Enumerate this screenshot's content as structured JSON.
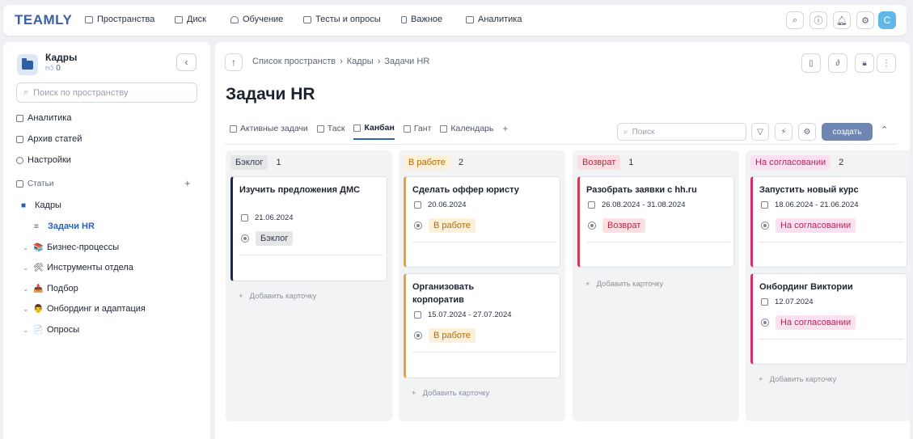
{
  "app": {
    "logo": "TEAMLY"
  },
  "topnav": {
    "items": [
      {
        "label": "Пространства",
        "icon": "spaces-icon"
      },
      {
        "label": "Диск",
        "icon": "folder-icon"
      },
      {
        "label": "Обучение",
        "icon": "graduation-icon"
      },
      {
        "label": "Тесты и опросы",
        "icon": "test-icon"
      },
      {
        "label": "Важное",
        "icon": "bookmark-icon"
      },
      {
        "label": "Аналитика",
        "icon": "analytics-icon"
      }
    ],
    "avatar": "C"
  },
  "sidebar": {
    "space_title": "Кадры",
    "likes": "0",
    "search_placeholder": "Поиск по пространству",
    "links": [
      "Аналитика",
      "Архив статей",
      "Настройки"
    ],
    "articles_label": "Статьи",
    "tree": [
      {
        "label": "Кадры",
        "emoji": "📁"
      },
      {
        "label": "Задачи HR",
        "emoji": "≡"
      },
      {
        "label": "Бизнес-процессы",
        "emoji": "📚"
      },
      {
        "label": "Инструменты отдела",
        "emoji": "🛠"
      },
      {
        "label": "Подбор",
        "emoji": "📥"
      },
      {
        "label": "Онбординг и адаптация",
        "emoji": "👨‍💼"
      },
      {
        "label": "Опросы",
        "emoji": "📄"
      }
    ]
  },
  "main": {
    "breadcrumb": [
      "Список пространств",
      "Кадры",
      "Задачи HR"
    ],
    "title": "Задачи HR",
    "tabs": [
      "Активные задачи",
      "Таск",
      "Канбан",
      "Гант",
      "Календарь"
    ],
    "active_tab": "Канбан",
    "search_placeholder": "Поиск",
    "create_label": "создать"
  },
  "board": {
    "add_card_label": "Добавить карточку",
    "columns": [
      {
        "name": "Бэклог",
        "count": "1",
        "color": "#1d2a4e",
        "badge_bg": "#e4e6ea",
        "badge_fg": "#333a47",
        "cards": [
          {
            "title": "Изучить предложения ДМС",
            "date": "21.06.2024",
            "status": "Бэклог"
          }
        ]
      },
      {
        "name": "В работе",
        "count": "2",
        "color": "#f0a033",
        "badge_bg": "#fdf0d8",
        "badge_fg": "#b56a00",
        "cards": [
          {
            "title": "Сделать оффер юристу",
            "date": "20.06.2024",
            "status": "В работе"
          },
          {
            "title": "Организовать корпоратив",
            "date": "15.07.2024 - 27.07.2024",
            "status": "В работе"
          }
        ]
      },
      {
        "name": "Возврат",
        "count": "1",
        "color": "#d23a55",
        "badge_bg": "#fcdfe3",
        "badge_fg": "#b32a40",
        "cards": [
          {
            "title": "Разобрать заявки с hh.ru",
            "date": "26.08.2024 - 31.08.2024",
            "status": "Возврат"
          }
        ]
      },
      {
        "name": "На согласовании",
        "count": "2",
        "color": "#d22f6b",
        "badge_bg": "#fbe0ef",
        "badge_fg": "#b4255a",
        "cards": [
          {
            "title": "Запустить новый курс",
            "date": "18.06.2024 - 21.06.2024",
            "status": "На согласовании"
          },
          {
            "title": "Онбординг Виктории",
            "date": "12.07.2024",
            "status": "На согласовании"
          }
        ]
      }
    ]
  }
}
